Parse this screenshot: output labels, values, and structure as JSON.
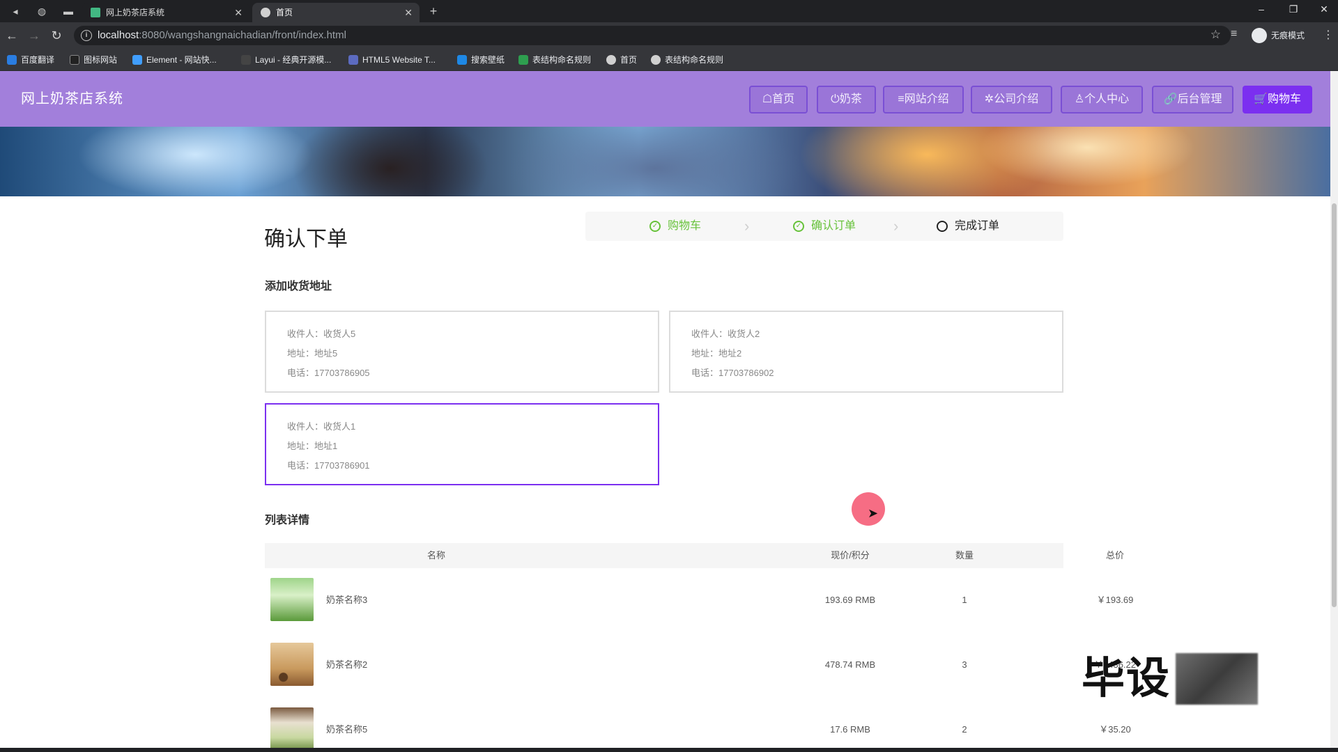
{
  "browser": {
    "tabs": [
      {
        "title": "网上奶茶店系统",
        "active": false
      },
      {
        "title": "首页",
        "active": true
      }
    ],
    "new_tab": "+",
    "url_host": "localhost",
    "url_rest": ":8080/wangshangnaichadian/front/index.html",
    "profile_label": "无痕模式",
    "bookmarks": [
      "百度翻译",
      "图标网站",
      "Element - 网站快...",
      "Layui - 经典开源模...",
      "HTML5 Website T...",
      "搜索壁纸",
      "表结构命名规则",
      "首页",
      "表结构命名规则"
    ]
  },
  "header": {
    "brand": "网上奶茶店系统",
    "nav": [
      "☖首页",
      "⏻奶茶",
      "≡网站介绍",
      "✲公司介绍",
      "♙个人中心",
      "🔗后台管理",
      "🛒购物车"
    ]
  },
  "page": {
    "title": "确认下单",
    "steps": [
      {
        "label": "购物车",
        "state": "done"
      },
      {
        "label": "确认订单",
        "state": "done"
      },
      {
        "label": "完成订单",
        "state": "current"
      }
    ],
    "address_section_title": "添加收货地址",
    "addresses": [
      {
        "recipient": "收件人：收货人5",
        "address": "地址：地址5",
        "phone": "电话：17703786905",
        "selected": false
      },
      {
        "recipient": "收件人：收货人2",
        "address": "地址：地址2",
        "phone": "电话：17703786902",
        "selected": false
      },
      {
        "recipient": "收件人：收货人1",
        "address": "地址：地址1",
        "phone": "电话：17703786901",
        "selected": true
      }
    ],
    "list_section_title": "列表详情",
    "table": {
      "headers": [
        "名称",
        "现价/积分",
        "数量",
        "总价"
      ],
      "rows": [
        {
          "name": "奶茶名称3",
          "price": "193.69 RMB",
          "qty": "1",
          "total": "￥193.69"
        },
        {
          "name": "奶茶名称2",
          "price": "478.74 RMB",
          "qty": "3",
          "total": "￥1436.22"
        },
        {
          "name": "奶茶名称5",
          "price": "17.6 RMB",
          "qty": "2",
          "total": "￥35.20"
        }
      ]
    }
  },
  "watermark": "毕设",
  "colors": {
    "header_bg": "#a27fdb",
    "accent": "#7b2ff0",
    "step_done": "#67c23a"
  }
}
